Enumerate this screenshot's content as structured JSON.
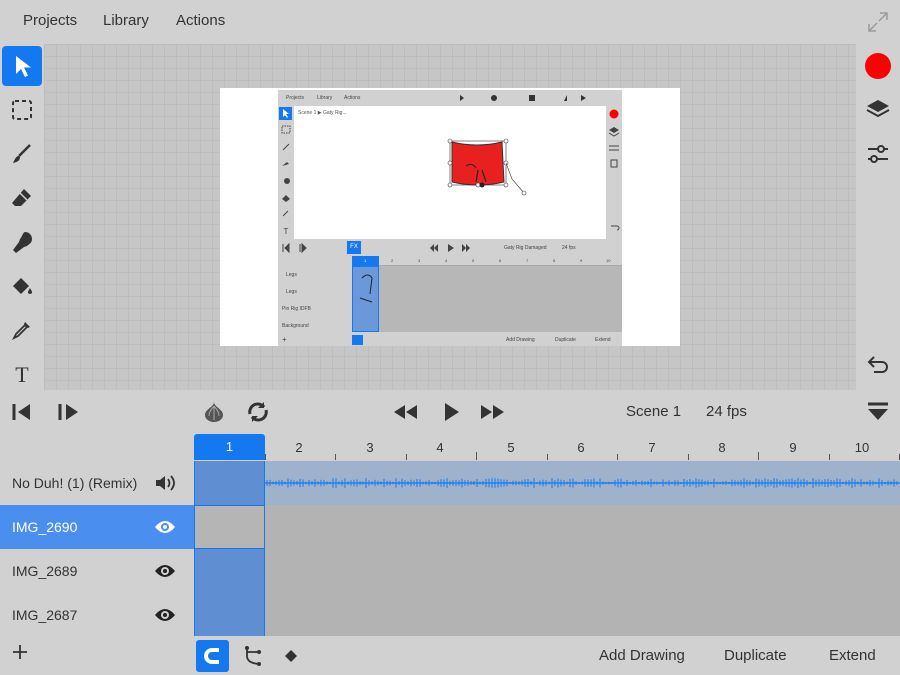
{
  "menu": {
    "projects": "Projects",
    "library": "Library",
    "actions": "Actions"
  },
  "canvas_preview": {
    "menu": {
      "projects": "Projects",
      "library": "Library",
      "actions": "Actions"
    },
    "breadcrumb": {
      "scene": "Scene 1",
      "separator": "▶",
      "layer": "Gaty Rig..."
    },
    "controls": {
      "fx": "FX",
      "title": "Gaty Rig Damaged",
      "fps": "24 fps"
    },
    "frame_numbers": [
      "1",
      "2",
      "3",
      "4",
      "5",
      "6",
      "7",
      "8",
      "9",
      "10"
    ],
    "layers": [
      "Legs",
      "Legs",
      "Pin Rig IDFB",
      "Background"
    ],
    "bottom": {
      "add_drawing": "Add Drawing",
      "duplicate": "Duplicate",
      "extend": "Extend"
    }
  },
  "playback": {
    "scene": "Scene 1",
    "fps": "24 fps"
  },
  "timeline": {
    "current_frame": "1",
    "frame_numbers": [
      "2",
      "3",
      "4",
      "5",
      "6",
      "7",
      "8",
      "9",
      "10"
    ],
    "layers": [
      {
        "name": "No Duh! (1) (Remix)",
        "icon": "speaker-icon"
      },
      {
        "name": "IMG_2690",
        "icon": "eye-icon"
      },
      {
        "name": "IMG_2689",
        "icon": "eye-icon"
      },
      {
        "name": "IMG_2687",
        "icon": "eye-icon"
      }
    ],
    "selected_layer_index": 1
  },
  "bottom": {
    "add_drawing": "Add Drawing",
    "duplicate": "Duplicate",
    "extend": "Extend"
  },
  "colors": {
    "accent": "#1479f0",
    "current_color": "#ff0000",
    "selected_layer": "#4a8ff0",
    "cell_fill": "#5f8fd2"
  }
}
